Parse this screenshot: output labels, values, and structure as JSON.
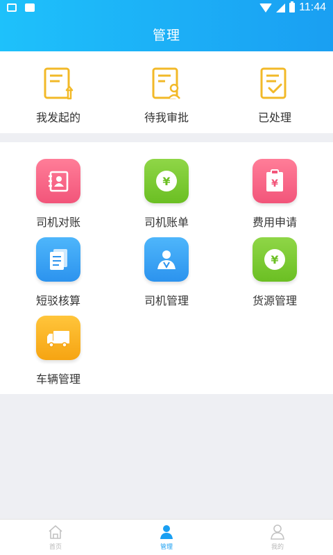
{
  "status_bar": {
    "time": "11:44"
  },
  "header": {
    "title": "管理"
  },
  "approvals": [
    {
      "label": "我发起的",
      "icon": "document-upload-icon"
    },
    {
      "label": "待我审批",
      "icon": "document-user-icon"
    },
    {
      "label": "已处理",
      "icon": "document-check-icon"
    }
  ],
  "modules": [
    {
      "label": "司机对账",
      "icon": "contact-book-icon",
      "color": "#f2557a"
    },
    {
      "label": "司机账单",
      "icon": "yen-coin-icon",
      "color": "#6bbf23"
    },
    {
      "label": "费用申请",
      "icon": "yen-clipboard-icon",
      "color": "#f2557a"
    },
    {
      "label": "短驳核算",
      "icon": "documents-stack-icon",
      "color": "#2c93ee"
    },
    {
      "label": "司机管理",
      "icon": "driver-icon",
      "color": "#2c93ee"
    },
    {
      "label": "货源管理",
      "icon": "yen-coin-icon",
      "color": "#6bbf23"
    },
    {
      "label": "车辆管理",
      "icon": "truck-icon",
      "color": "#f6a412"
    }
  ],
  "tabbar": {
    "tabs": [
      {
        "label": "首页",
        "icon": "home-icon"
      },
      {
        "label": "管理",
        "icon": "manage-icon",
        "active": true
      },
      {
        "label": "我的",
        "icon": "profile-icon"
      }
    ]
  },
  "colors": {
    "accent": "#1a9ff2",
    "doc_icon": "#f2b928"
  }
}
